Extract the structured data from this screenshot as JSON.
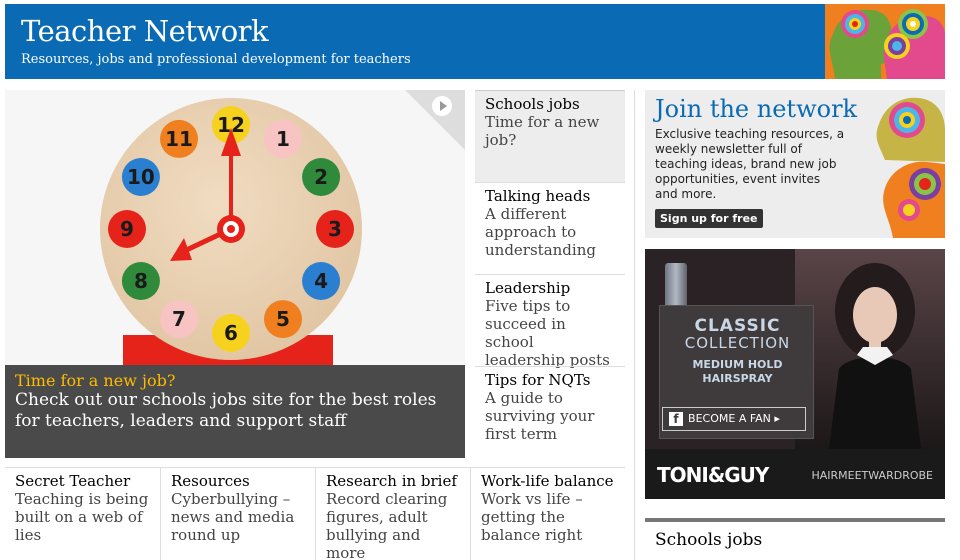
{
  "header": {
    "title": "Teacher Network",
    "subtitle": "Resources, jobs and professional development for teachers"
  },
  "hero": {
    "kicker": "Time for a new job?",
    "text": "Check out our schools jobs site for the best roles for teachers, leaders and support staff",
    "clock_numbers": [
      "12",
      "1",
      "2",
      "3",
      "4",
      "5",
      "6",
      "7",
      "8",
      "9",
      "10",
      "11"
    ]
  },
  "mid_cards": [
    {
      "head": "Schools jobs",
      "sub": "Time for a new job?"
    },
    {
      "head": "Talking heads",
      "sub": "A different approach to understanding"
    },
    {
      "head": "Leadership",
      "sub": "Five tips to succeed in school leadership posts"
    },
    {
      "head": "Tips for NQTs",
      "sub": "A guide to surviving your first term"
    }
  ],
  "bottom_cards": [
    {
      "head": "Secret Teacher",
      "sub": "Teaching is being built on a web of lies"
    },
    {
      "head": "Resources",
      "sub": "Cyberbullying – news and media round up"
    },
    {
      "head": "Research in brief",
      "sub": "Record clearing figures, adult bullying and more"
    },
    {
      "head": "Work-life balance",
      "sub": "Work vs life – getting the balance right"
    }
  ],
  "promo": {
    "title": "Join the network",
    "text": "Exclusive teaching resources, a weekly newsletter full of teaching ideas, brand new job opportunities, event invites and more.",
    "button": "Sign up for free"
  },
  "ad": {
    "line1": "CLASSIC",
    "line2": "COLLECTION",
    "line3": "MEDIUM HOLD",
    "line4": "HAIRSPRAY",
    "fan": "BECOME A FAN",
    "brand": "TONI&GUY",
    "tagline": "HAIRMEETWARDROBE"
  },
  "jobs_heading": "Schools jobs"
}
